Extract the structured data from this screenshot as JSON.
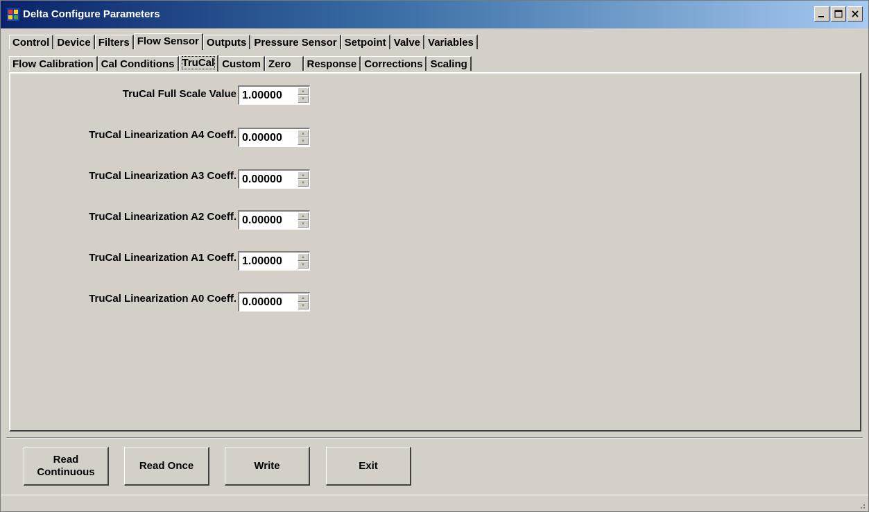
{
  "window": {
    "title": "Delta Configure Parameters"
  },
  "tabs_main": [
    {
      "label": "Control"
    },
    {
      "label": "Device"
    },
    {
      "label": "Filters"
    },
    {
      "label": "Flow Sensor"
    },
    {
      "label": "Outputs"
    },
    {
      "label": "Pressure Sensor"
    },
    {
      "label": "Setpoint"
    },
    {
      "label": "Valve"
    },
    {
      "label": "Variables"
    }
  ],
  "tabs_main_active": "Flow Sensor",
  "tabs_sub": [
    {
      "label": "Flow Calibration"
    },
    {
      "label": "Cal Conditions"
    },
    {
      "label": "TruCal"
    },
    {
      "label": "Custom"
    },
    {
      "label": "Zero"
    },
    {
      "label": "Response"
    },
    {
      "label": "Corrections"
    },
    {
      "label": "Scaling"
    }
  ],
  "tabs_sub_active": "TruCal",
  "fields": [
    {
      "label": "TruCal Full Scale Value",
      "value": "1.00000"
    },
    {
      "label": "TruCal Linearization A4 Coeff.",
      "value": "0.00000"
    },
    {
      "label": "TruCal Linearization A3 Coeff.",
      "value": "0.00000"
    },
    {
      "label": "TruCal Linearization A2 Coeff.",
      "value": "0.00000"
    },
    {
      "label": "TruCal Linearization A1 Coeff.",
      "value": "1.00000"
    },
    {
      "label": "TruCal Linearization A0 Coeff.",
      "value": "0.00000"
    }
  ],
  "buttons": {
    "read_continuous_line1": "Read",
    "read_continuous_line2": "Continuous",
    "read_once": "Read Once",
    "write": "Write",
    "exit": "Exit"
  },
  "icons": {
    "app": "app-icon",
    "minimize": "minimize-icon",
    "maximize": "maximize-icon",
    "close": "close-icon",
    "spin_up": "spin-up-arrow-icon",
    "spin_down": "spin-down-arrow-icon",
    "grip": "resize-grip-icon"
  },
  "colors": {
    "titlebar_start": "#0a246a",
    "titlebar_end": "#a6caf0",
    "face": "#d4d0c8"
  }
}
